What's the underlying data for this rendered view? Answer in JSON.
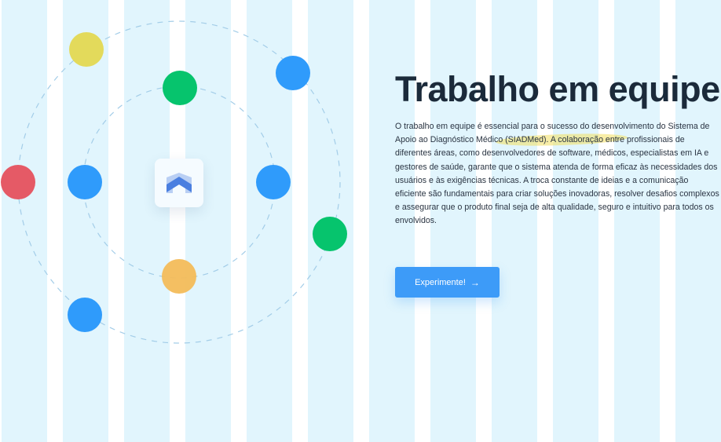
{
  "section": {
    "title": "Trabalho em equipe",
    "description": "O trabalho em equipe é essencial para o sucesso do desenvolvimento do Sistema de Apoio ao Diagnóstico Médico (SIADMed). A colaboração entre profissionais de diferentes áreas, como desenvolvedores de software, médicos, especialistas em IA e gestores de saúde, garante que o sistema atenda de forma eficaz às necessidades dos usuários e às exigências técnicas. A troca constante de ideias e a comunicação eficiente são fundamentais para criar soluções inovadoras, resolver desafios complexos e assegurar que o produto final seja de alta qualidade, seguro e intuitivo para todos os envolvidos.",
    "cta_label": "Experimente!",
    "cta_icon": "arrow-right-icon"
  },
  "colors": {
    "stripe": "#e1f5fd",
    "title": "#1b2a3a",
    "button": "#3d9bf8",
    "dot_blue": "#2f9bfb",
    "dot_green": "#06c46d",
    "dot_yellow": "#e3da5b",
    "dot_red": "#e55a66",
    "dot_orange": "#f3bc5a",
    "logo": "#4a7fe0"
  }
}
